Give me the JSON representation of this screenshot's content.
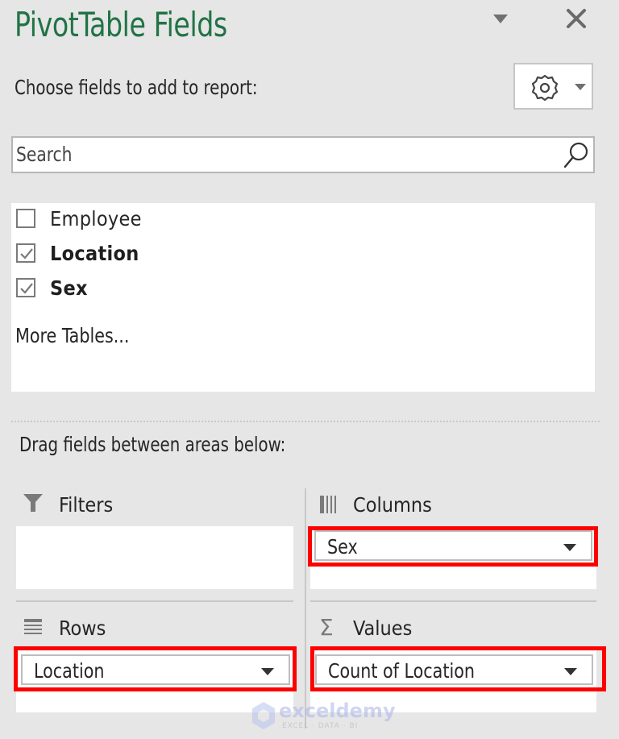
{
  "panel": {
    "title": "PivotTable Fields",
    "pane_menu_icon": "caret-down-icon",
    "close_icon": "close-icon",
    "subtitle": "Choose fields to add to report:",
    "tools_icon": "gear-icon"
  },
  "search": {
    "placeholder": "Search",
    "icon": "search-icon"
  },
  "fields": [
    {
      "label": "Employee",
      "checked": false
    },
    {
      "label": "Location",
      "checked": true
    },
    {
      "label": "Sex",
      "checked": true
    }
  ],
  "more_tables_label": "More Tables...",
  "drag_label": "Drag fields between areas below:",
  "areas": {
    "filters": {
      "label": "Filters",
      "icon": "filter-icon",
      "items": []
    },
    "columns": {
      "label": "Columns",
      "icon": "columns-icon",
      "items": [
        "Sex"
      ]
    },
    "rows": {
      "label": "Rows",
      "icon": "rows-icon",
      "items": [
        "Location"
      ]
    },
    "values": {
      "label": "Values",
      "icon": "sigma-icon",
      "items": [
        "Count of Location"
      ]
    }
  },
  "highlight_color": "#ff0000",
  "accent_color": "#217346",
  "watermark": {
    "name": "exceldemy",
    "tagline": "EXCEL · DATA · BI"
  }
}
